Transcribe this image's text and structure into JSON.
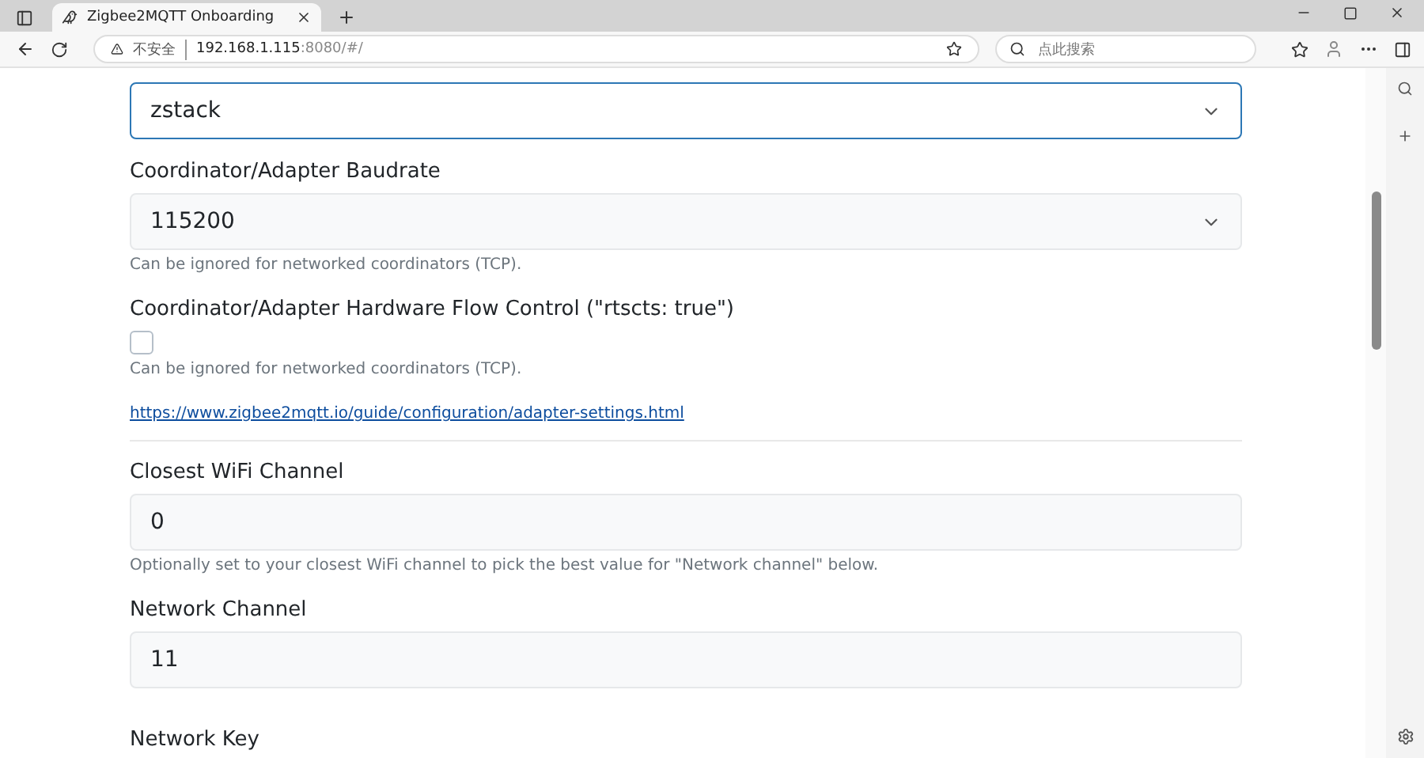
{
  "browser": {
    "tab_title": "Zigbee2MQTT Onboarding",
    "security_label": "不安全",
    "url_host": "192.168.1.115",
    "url_rest": ":8080/#/",
    "search_placeholder": "点此搜索"
  },
  "form": [
    {
      "kind": "select",
      "value": "zstack",
      "focused": true
    },
    {
      "kind": "label",
      "text": "Coordinator/Adapter Baudrate"
    },
    {
      "kind": "select",
      "value": "115200",
      "focused": false
    },
    {
      "kind": "help",
      "text": "Can be ignored for networked coordinators (TCP)."
    },
    {
      "kind": "label",
      "text": "Coordinator/Adapter Hardware Flow Control (\"rtscts: true\")"
    },
    {
      "kind": "checkbox",
      "checked": false
    },
    {
      "kind": "help",
      "text": "Can be ignored for networked coordinators (TCP)."
    },
    {
      "kind": "link",
      "text": "https://www.zigbee2mqtt.io/guide/configuration/adapter-settings.html"
    },
    {
      "kind": "divider"
    },
    {
      "kind": "label",
      "text": "Closest WiFi Channel"
    },
    {
      "kind": "input",
      "value": "0"
    },
    {
      "kind": "help",
      "text": "Optionally set to your closest WiFi channel to pick the best value for \"Network channel\" below."
    },
    {
      "kind": "label",
      "text": "Network Channel"
    },
    {
      "kind": "input",
      "value": "11"
    },
    {
      "kind": "label",
      "text": "Network Key"
    }
  ]
}
